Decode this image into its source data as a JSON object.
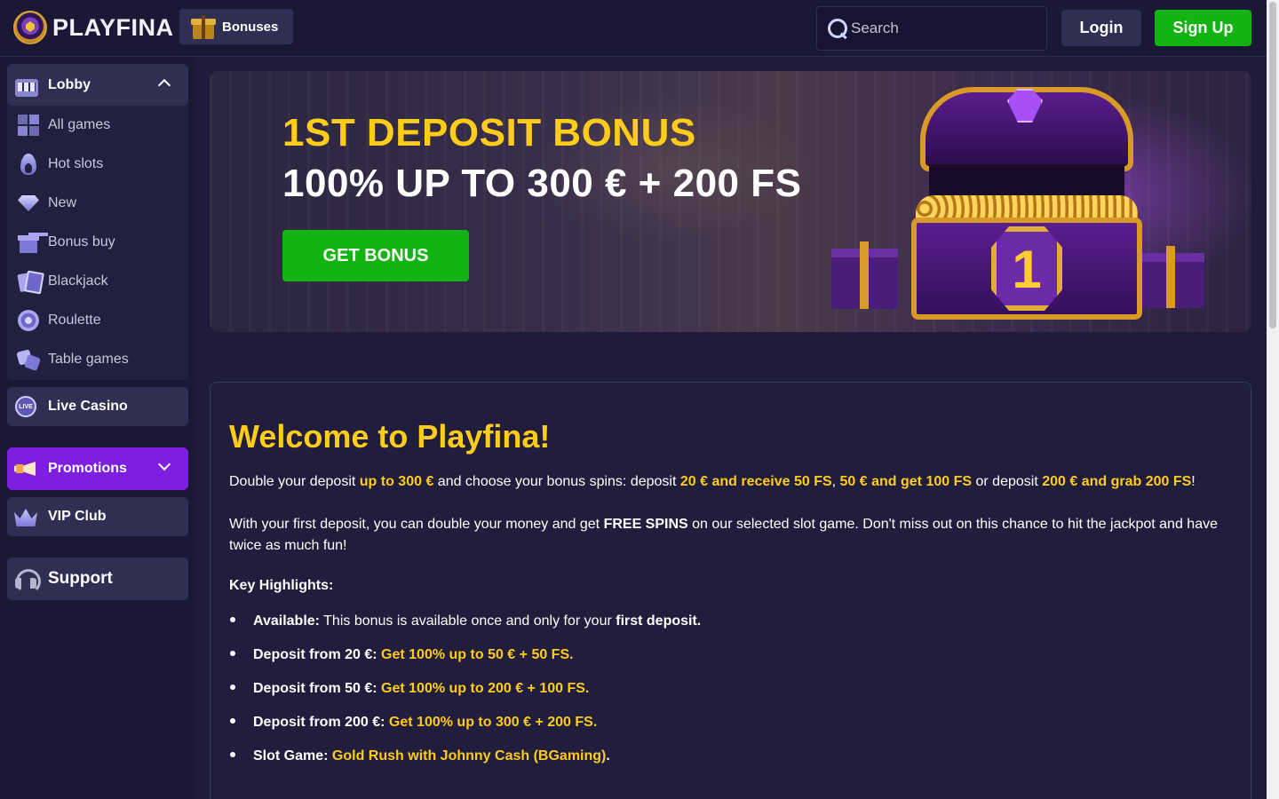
{
  "header": {
    "logo_text": "PLAYFINA",
    "bonuses_label": "Bonuses",
    "search_placeholder": "Search",
    "login_label": "Login",
    "signup_label": "Sign Up"
  },
  "sidebar": {
    "lobby_label": "Lobby",
    "lobby_items": [
      {
        "label": "All games",
        "icon": "grid-icon"
      },
      {
        "label": "Hot slots",
        "icon": "flame-icon"
      },
      {
        "label": "New",
        "icon": "diamond-icon"
      },
      {
        "label": "Bonus buy",
        "icon": "gift-icon"
      },
      {
        "label": "Blackjack",
        "icon": "cards-icon"
      },
      {
        "label": "Roulette",
        "icon": "roulette-icon"
      },
      {
        "label": "Table games",
        "icon": "dice-icon"
      }
    ],
    "live_casino_label": "Live Casino",
    "promotions_label": "Promotions",
    "vip_label": "VIP Club",
    "support_label": "Support"
  },
  "banner": {
    "title": "1ST DEPOSIT BONUS",
    "subtitle": "100% UP TO 300 € + 200 FS",
    "cta_label": "GET BONUS",
    "chest_number": "1"
  },
  "content": {
    "heading": "Welcome to Playfina!",
    "intro": {
      "t1": "Double your deposit ",
      "h1": "up to 300 €",
      "t2": " and choose your bonus spins: deposit ",
      "h2": "20 € and receive 50 FS",
      "t3": ", ",
      "h3": "50 € and get 100 FS",
      "t4": " or deposit ",
      "h4": "200 € and grab 200 FS",
      "t5": "!"
    },
    "second": {
      "t1": "With your first deposit, you can double your money and get ",
      "b1": "FREE SPINS",
      "t2": " on our selected slot game. Don't miss out on this chance to hit the jackpot and have twice as much fun!"
    },
    "highlights_title": "Key Highlights:",
    "bullets": [
      {
        "label": "Available:",
        "text": " This bonus is available once and only for your ",
        "bold_tail": "first deposit."
      },
      {
        "label": "Deposit from 20 €:",
        "highlight": " Get 100% up to 50 € + 50 FS."
      },
      {
        "label": "Deposit from 50 €:",
        "highlight": " Get 100% up to 200 € + 100 FS."
      },
      {
        "label": "Deposit from 200 €:",
        "highlight": " Get 100% up to 300 € + 200 FS."
      },
      {
        "label": "Slot Game:",
        "highlight": " Gold Rush with Johnny Cash (BGaming)",
        "tail": "."
      }
    ]
  },
  "colors": {
    "accent_yellow": "#ffcc1a",
    "cta_green": "#12b312",
    "promo_purple": "#7c1fe0",
    "background": "#1e1c3a"
  }
}
